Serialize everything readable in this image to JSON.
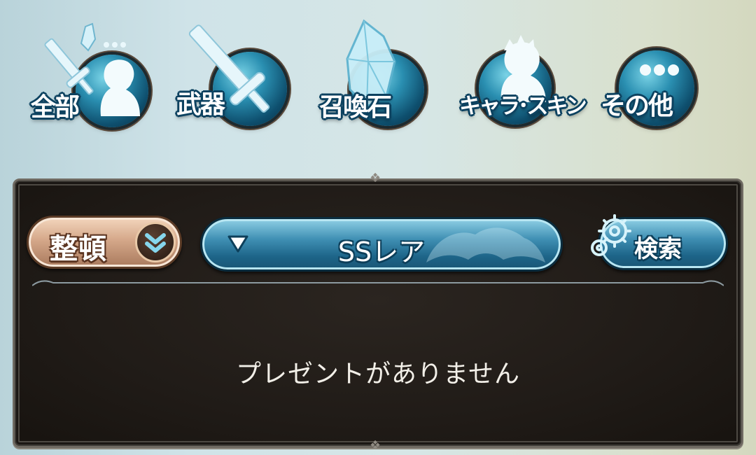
{
  "categories": [
    {
      "id": "all",
      "label": "全部",
      "icon": "sword-crystal-character-icon"
    },
    {
      "id": "weapon",
      "label": "武器",
      "icon": "sword-icon"
    },
    {
      "id": "summon",
      "label": "召喚石",
      "icon": "crystal-icon"
    },
    {
      "id": "character",
      "label": "キャラ･スキン",
      "icon": "character-silhouette-icon"
    },
    {
      "id": "other",
      "label": "その他",
      "icon": "ellipsis-icon"
    }
  ],
  "toolbar": {
    "sort_label": "整頓",
    "sort_icon": "double-chevron-down-icon",
    "filter_value": "SSレア",
    "filter_icon": "triangle-down-icon",
    "search_label": "検索",
    "search_icon": "gear-icon"
  },
  "empty_message": "プレゼントがありません",
  "colors": {
    "accent": "#2a8fb1",
    "sort_button": "#d5a88a",
    "panel": "#201b17"
  }
}
